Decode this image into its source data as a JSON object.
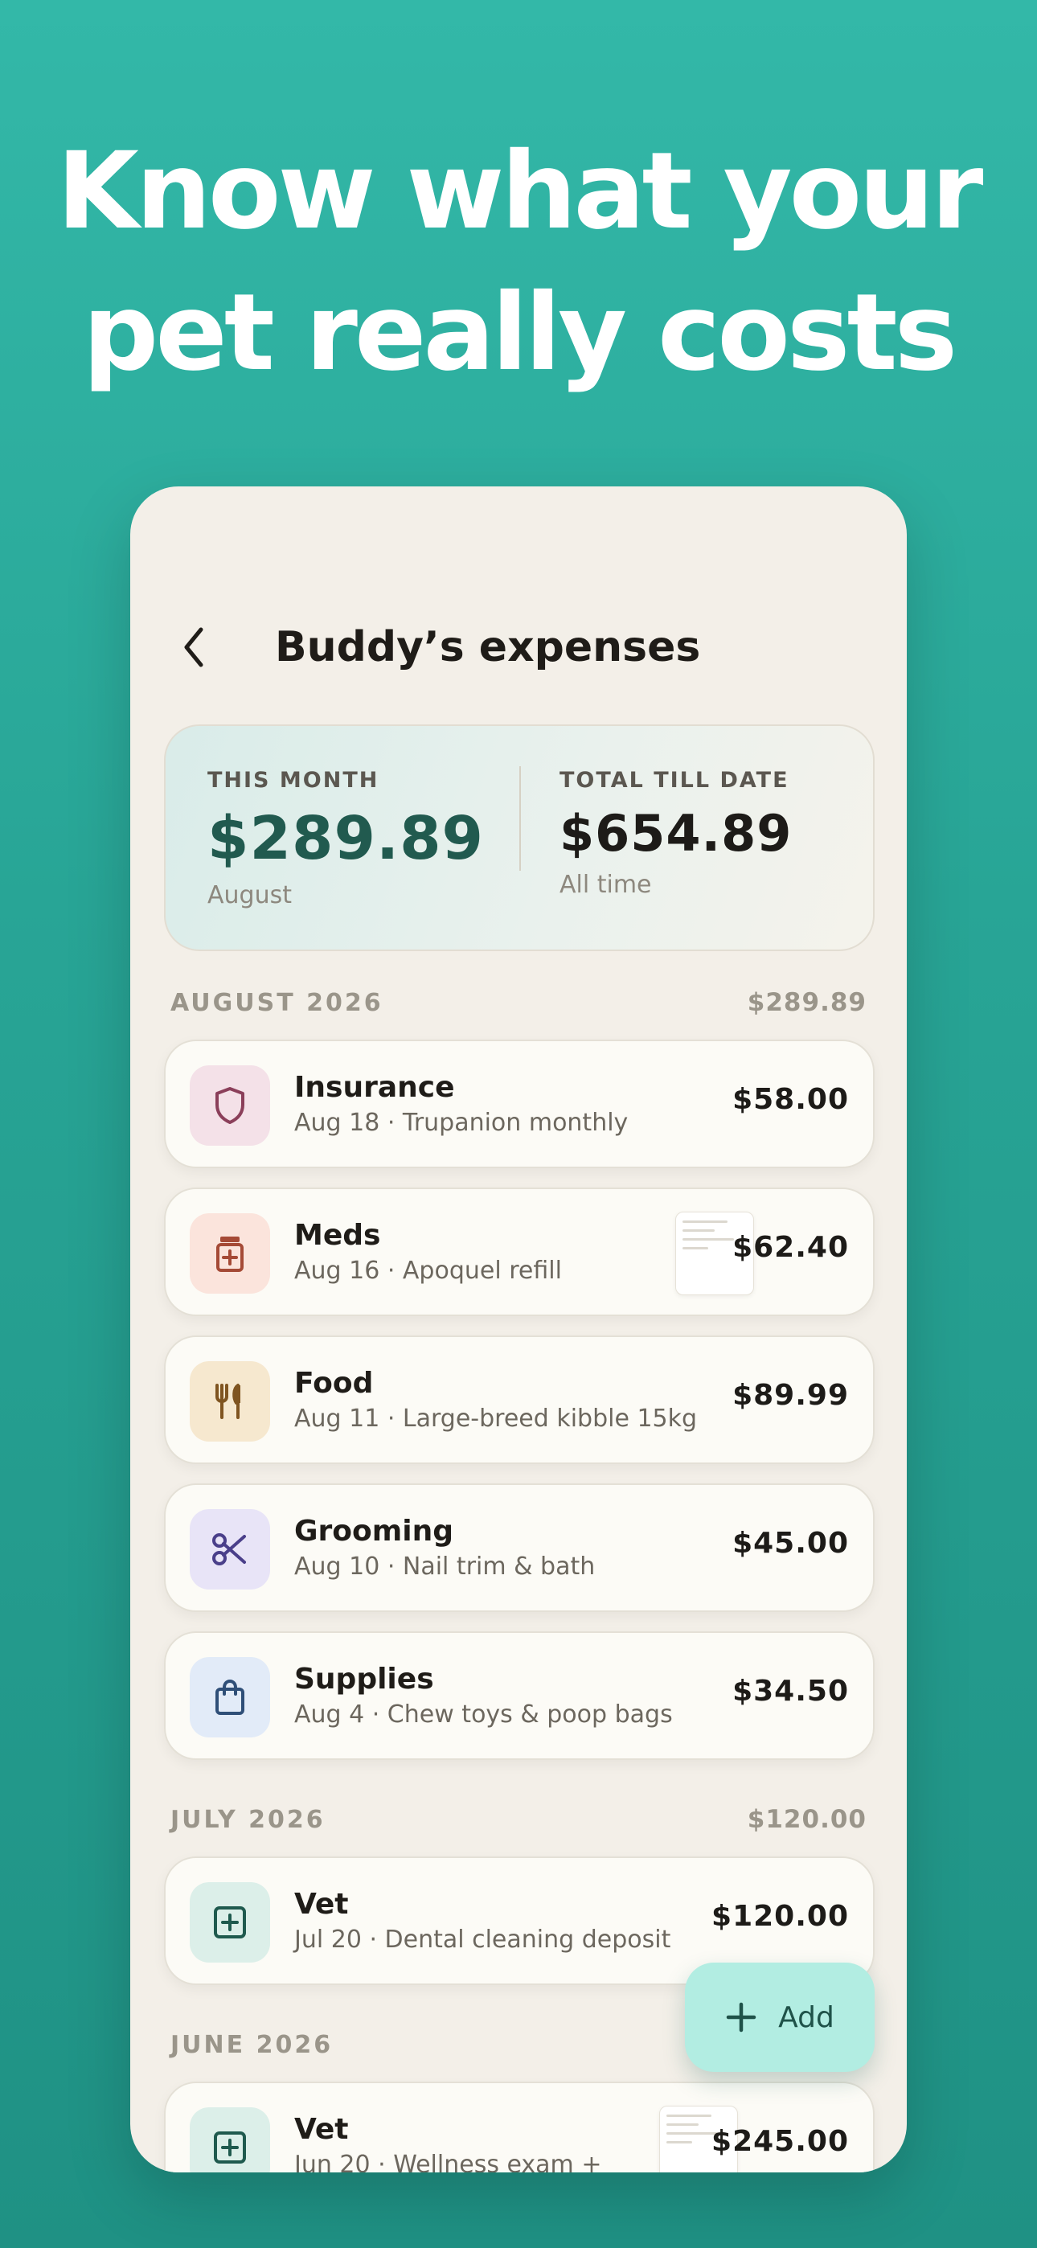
{
  "headline": {
    "line1": "Know what your",
    "line2": "pet really costs"
  },
  "screen": {
    "title": "Buddy’s expenses",
    "back_icon": "chevron-left-icon"
  },
  "summary": {
    "this_month": {
      "label": "THIS MONTH",
      "value": "$289.89",
      "sub": "August"
    },
    "total": {
      "label": "TOTAL TILL DATE",
      "value": "$654.89",
      "sub": "All time"
    }
  },
  "sections": [
    {
      "label": "AUGUST 2026",
      "total": "$289.89",
      "items": [
        {
          "title": "Insurance",
          "subtitle": "Aug 18 · Trupanion monthly",
          "amount": "$58.00",
          "icon": "shield-icon",
          "tile_color": "#f4e1e8",
          "icon_color": "#8b3f5a",
          "receipt": false
        },
        {
          "title": "Meds",
          "subtitle": "Aug 16 · Apoquel refill",
          "amount": "$62.40",
          "icon": "medicine-jar-icon",
          "tile_color": "#fbe4dc",
          "icon_color": "#a54a36",
          "receipt": true
        },
        {
          "title": "Food",
          "subtitle": "Aug 11 · Large-breed kibble 15kg",
          "amount": "$89.99",
          "icon": "fork-knife-icon",
          "tile_color": "#f6e8cf",
          "icon_color": "#7f5420",
          "receipt": false
        },
        {
          "title": "Grooming",
          "subtitle": "Aug 10 · Nail trim & bath",
          "amount": "$45.00",
          "icon": "scissors-icon",
          "tile_color": "#e8e4f7",
          "icon_color": "#4a3f8a",
          "receipt": false
        },
        {
          "title": "Supplies",
          "subtitle": "Aug 4 · Chew toys & poop bags",
          "amount": "$34.50",
          "icon": "shopping-bag-icon",
          "tile_color": "#e2ebf8",
          "icon_color": "#2f4f78",
          "receipt": false
        }
      ]
    },
    {
      "label": "JULY 2026",
      "total": "$120.00",
      "items": [
        {
          "title": "Vet",
          "subtitle": "Jul 20 · Dental cleaning deposit",
          "amount": "$120.00",
          "icon": "medical-plus-icon",
          "tile_color": "#dcefe9",
          "icon_color": "#1f5a4e",
          "receipt": false
        }
      ]
    },
    {
      "label": "JUNE 2026",
      "total": "",
      "items": [
        {
          "title": "Vet",
          "subtitle": "Jun 20 · Wellness exam +",
          "amount": "$245.00",
          "icon": "medical-plus-icon",
          "tile_color": "#dcefe9",
          "icon_color": "#1f5a4e",
          "receipt": true
        }
      ]
    }
  ],
  "add_button": {
    "label": "Add",
    "icon": "plus-icon"
  },
  "colors": {
    "accent": "#215a4f",
    "background_top": "#33b8a8",
    "add_button": "#b2ede2"
  }
}
